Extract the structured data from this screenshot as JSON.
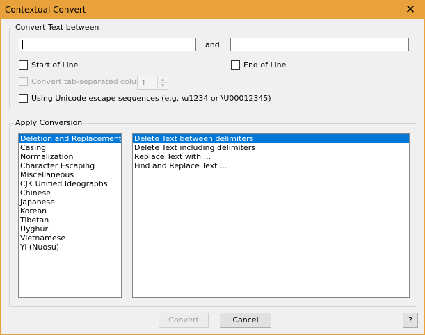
{
  "window": {
    "title": "Contextual Convert",
    "close_glyph": "✕"
  },
  "convert_group": {
    "legend": "Convert Text between",
    "start_value": "",
    "and_label": "and",
    "end_value": "",
    "start_of_line": "Start of Line",
    "end_of_line": "End of Line",
    "tab_column": "Convert tab-separated column",
    "tab_column_value": "1",
    "unicode_escape": "Using Unicode escape sequences (e.g. \\u1234 or \\U00012345)"
  },
  "apply_group": {
    "legend": "Apply Conversion",
    "categories": [
      "Deletion and Replacement",
      "Casing",
      "Normalization",
      "Character Escaping",
      "Miscellaneous",
      "CJK Unified Ideographs",
      "Chinese",
      "Japanese",
      "Korean",
      "Tibetan",
      "Uyghur",
      "Vietnamese",
      "Yi (Nuosu)"
    ],
    "selected_category": "Deletion and Replacement",
    "actions": [
      "Delete Text between delimiters",
      "Delete Text including delimiters",
      "Replace Text with ...",
      "Find and Replace Text ..."
    ],
    "selected_action": "Delete Text between delimiters"
  },
  "buttons": {
    "convert": "Convert",
    "cancel": "Cancel",
    "help": "?"
  },
  "colors": {
    "titlebar": "#e9a23b",
    "selection": "#0078d7"
  }
}
